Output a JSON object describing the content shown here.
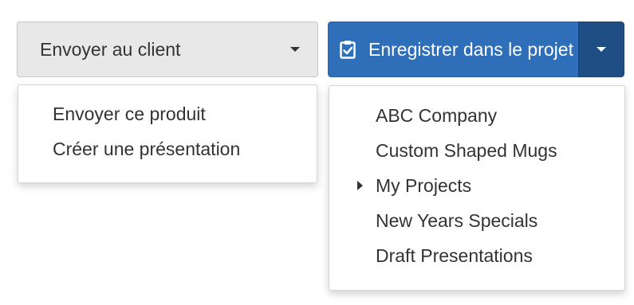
{
  "send_dropdown": {
    "label": "Envoyer au client",
    "menu": {
      "items": [
        {
          "label": "Envoyer ce produit"
        },
        {
          "label": "Créer une présentation"
        }
      ]
    }
  },
  "save_dropdown": {
    "label": "Enregistrer dans le projet",
    "icon": "clipboard-check-icon",
    "menu": {
      "items": [
        {
          "label": "ABC Company",
          "has_submenu": false
        },
        {
          "label": "Custom Shaped Mugs",
          "has_submenu": false
        },
        {
          "label": "My Projects",
          "has_submenu": true
        },
        {
          "label": "New Years Specials",
          "has_submenu": false
        },
        {
          "label": "Draft Presentations",
          "has_submenu": false
        }
      ]
    }
  },
  "colors": {
    "primary": "#2f6fb9",
    "primary_dark": "#1f4e85",
    "default_button": "#e8e8e8",
    "text": "#333333"
  }
}
